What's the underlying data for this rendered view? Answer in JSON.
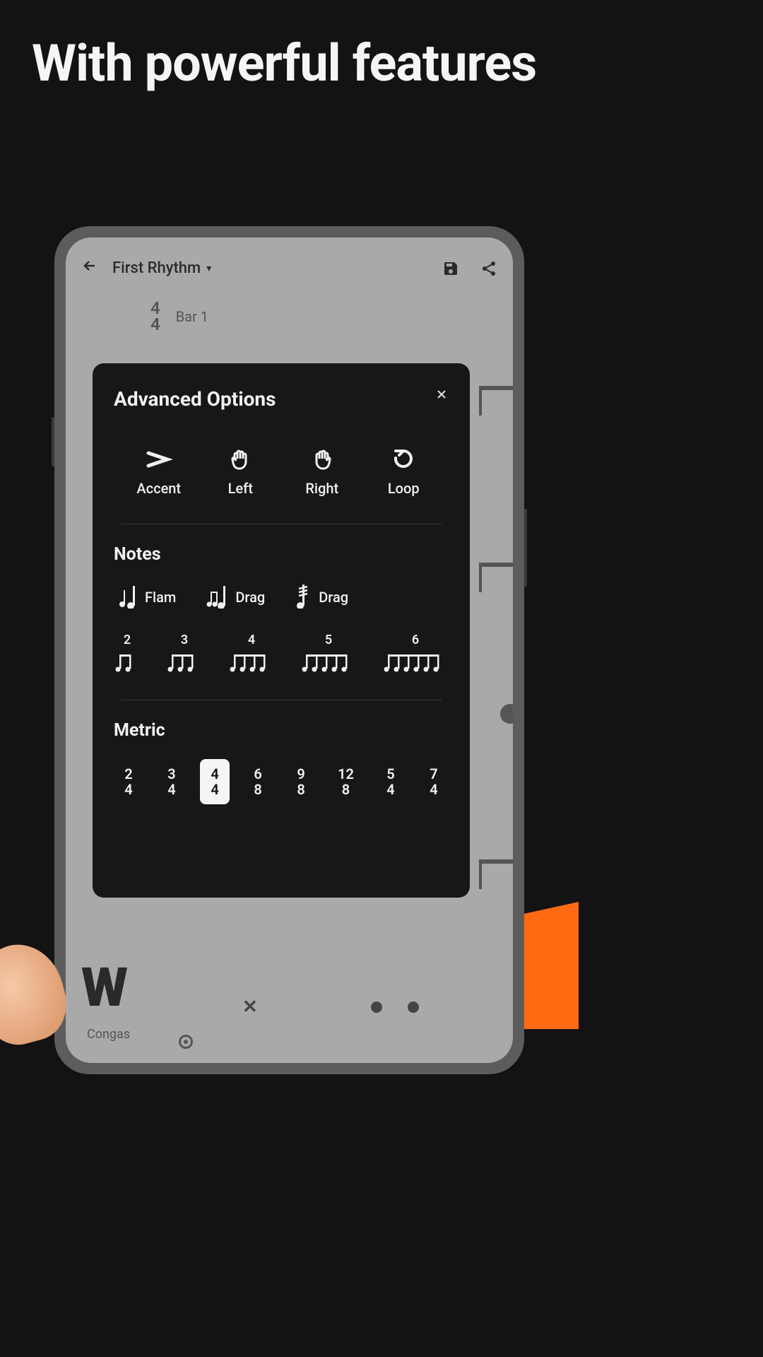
{
  "headline": "With powerful features",
  "app": {
    "title": "First Rhythm",
    "time_sig_top": "4",
    "time_sig_bottom": "4",
    "bar_label": "Bar 1",
    "track_name": "Congas"
  },
  "modal": {
    "title": "Advanced Options",
    "actions": [
      {
        "label": "Accent",
        "icon": "accent"
      },
      {
        "label": "Left",
        "icon": "hand-left"
      },
      {
        "label": "Right",
        "icon": "hand-right"
      },
      {
        "label": "Loop",
        "icon": "loop"
      }
    ],
    "notes_title": "Notes",
    "note_ornaments": [
      {
        "label": "Flam",
        "icon": "flam"
      },
      {
        "label": "Drag",
        "icon": "drag"
      },
      {
        "label": "Drag",
        "icon": "roll"
      }
    ],
    "tuplets": [
      2,
      3,
      4,
      5,
      6
    ],
    "metric_title": "Metric",
    "metrics": [
      {
        "top": "2",
        "bottom": "4",
        "selected": false
      },
      {
        "top": "3",
        "bottom": "4",
        "selected": false
      },
      {
        "top": "4",
        "bottom": "4",
        "selected": true
      },
      {
        "top": "6",
        "bottom": "8",
        "selected": false
      },
      {
        "top": "9",
        "bottom": "8",
        "selected": false
      },
      {
        "top": "12",
        "bottom": "8",
        "selected": false
      },
      {
        "top": "5",
        "bottom": "4",
        "selected": false
      },
      {
        "top": "7",
        "bottom": "4",
        "selected": false
      }
    ]
  }
}
